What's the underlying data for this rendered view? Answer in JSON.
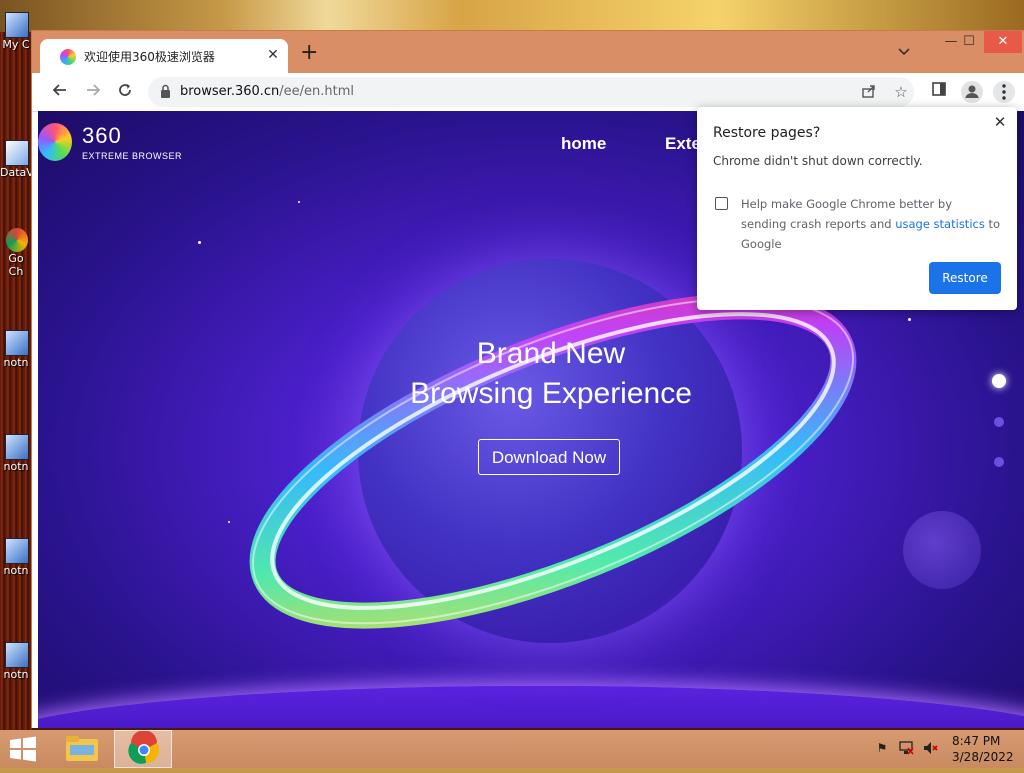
{
  "desktop": {
    "icons": [
      {
        "label": "My C"
      },
      {
        "label": "DataV"
      },
      {
        "label": "Go"
      },
      {
        "label": "Ch"
      },
      {
        "label": "notn"
      },
      {
        "label": "notn"
      },
      {
        "label": "notn"
      },
      {
        "label": "notn"
      }
    ]
  },
  "browser": {
    "tab": {
      "title": "欢迎使用360极速浏览器",
      "close": "✕"
    },
    "new_tab": "+",
    "url": {
      "host": "browser.360.cn",
      "path": "/ee/en.html"
    },
    "window_controls": {
      "minimize": "—",
      "maximize": "☐",
      "close": "✕"
    }
  },
  "page": {
    "logo": {
      "name": "360",
      "subtitle": "EXTREME BROWSER"
    },
    "nav": {
      "home": "home",
      "extensions": "Exte"
    },
    "hero": {
      "line1": "Brand New",
      "line2": "Browsing Experience",
      "cta": "Download Now"
    }
  },
  "restore_popup": {
    "title": "Restore pages?",
    "message": "Chrome didn't shut down correctly.",
    "help_text_before": "Help make Google Chrome better by sending crash reports and ",
    "help_link": "usage statistics",
    "help_text_after": " to Google",
    "restore_label": "Restore",
    "close": "✕"
  },
  "taskbar": {
    "time": "8:47 PM",
    "date": "3/28/2022"
  },
  "colors": {
    "accent_blue": "#1a73e8",
    "tabstrip": "#d98e66",
    "page_purple": "#4a1fc9"
  }
}
